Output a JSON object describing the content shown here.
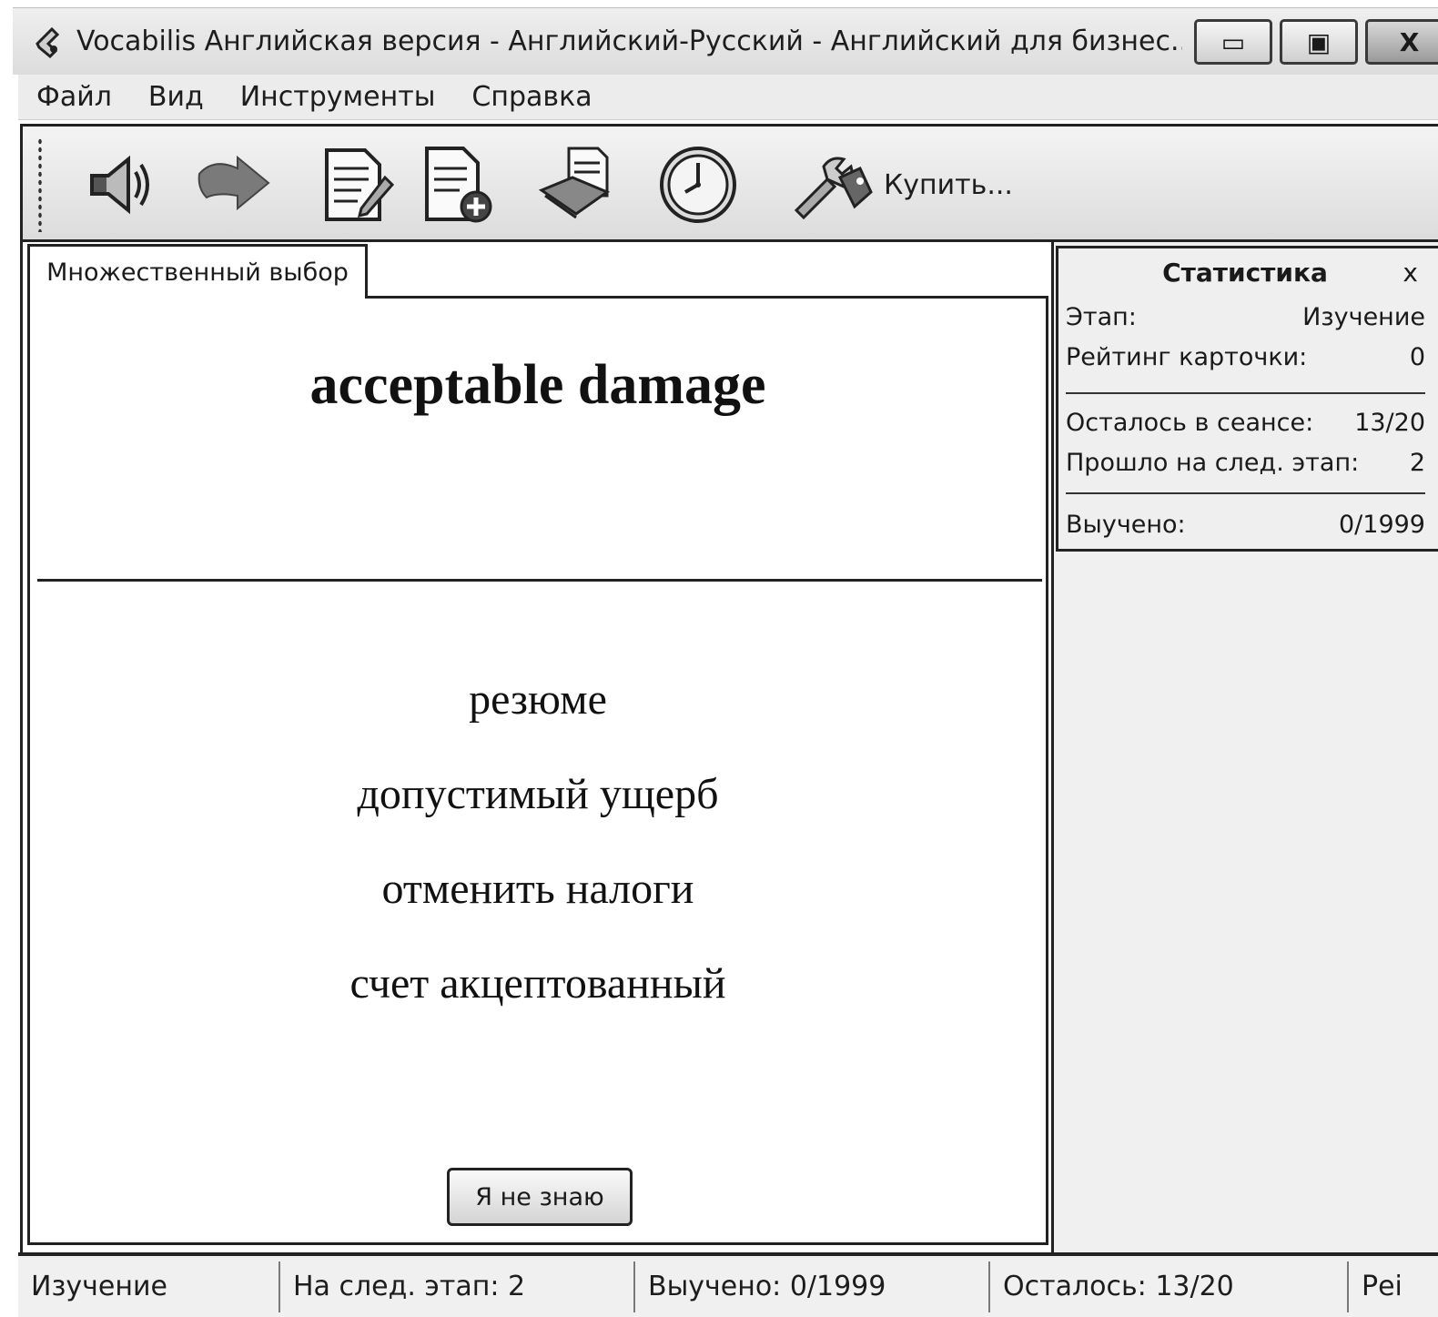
{
  "window": {
    "title": "Vocabilis Английская версия - Английский-Русский - Английский для бизнес...",
    "minimize_symbol": "▭",
    "maximize_symbol": "▣",
    "close_symbol": "X"
  },
  "menu": {
    "items": [
      "Файл",
      "Вид",
      "Инструменты",
      "Справка"
    ]
  },
  "toolbar": {
    "buttons": [
      {
        "icon": "speaker-icon"
      },
      {
        "icon": "forward-arrow-icon"
      },
      {
        "icon": "edit-document-icon"
      },
      {
        "icon": "add-document-icon"
      },
      {
        "icon": "open-book-icon"
      },
      {
        "icon": "clock-icon"
      },
      {
        "icon": "tools-price-tag-icon",
        "label": "Купить..."
      }
    ]
  },
  "tab": {
    "label": "Множественный выбор"
  },
  "card": {
    "question": "acceptable damage",
    "answers": [
      "резюме",
      "допустимый ущерб",
      "отменить налоги",
      "счет акцептованный"
    ],
    "dont_know_label": "Я не знаю"
  },
  "stats": {
    "title": "Статистика",
    "close_symbol": "x",
    "stage_label": "Этап:",
    "stage_value": "Изучение",
    "rating_label": "Рейтинг карточки:",
    "rating_value": "0",
    "remaining_label": "Осталось в сеансе:",
    "remaining_value": "13/20",
    "passed_label": "Прошло на след. этап:",
    "passed_value": "2",
    "learned_label": "Выучено:",
    "learned_value": "0/1999"
  },
  "status": {
    "stage": "Изучение",
    "next_stage": "На след. этап: 2",
    "learned": "Выучено: 0/1999",
    "remaining": "Осталось: 13/20",
    "truncated": "Рei"
  }
}
